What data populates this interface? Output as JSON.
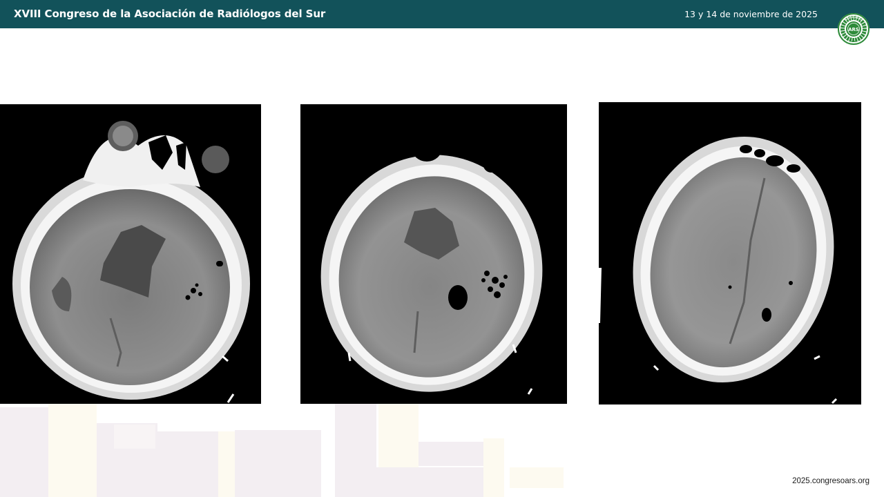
{
  "header": {
    "title": "XVIII Congreso de la Asociación de Radiólogos del Sur",
    "date": "13 y 14 de noviembre de 2025",
    "logo_text": "ARS",
    "logo_ring_top": "RADIÓLOGOS",
    "logo_ring_left": "ASOCIACIÓN",
    "logo_ring_bottom": "SUR"
  },
  "colors": {
    "header_bg": "#12525a",
    "logo_green": "#2e8b3a"
  },
  "images": [
    {
      "name": "ct-scan-axial-1",
      "icon": "brain-ct-image"
    },
    {
      "name": "ct-scan-axial-2",
      "icon": "brain-ct-image"
    },
    {
      "name": "ct-scan-axial-3",
      "icon": "brain-ct-image"
    }
  ],
  "footer": {
    "url": "2025.congresoars.org"
  }
}
